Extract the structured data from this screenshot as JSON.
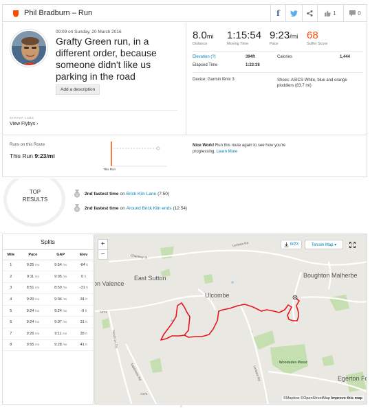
{
  "header": {
    "title": "Phil Bradburn – Run",
    "kudos_count": "1",
    "comment_count": "0",
    "icons": [
      "strava-shield-icon",
      "facebook-icon",
      "twitter-icon",
      "share-icon",
      "thumbs-up-icon",
      "comment-icon"
    ]
  },
  "activity": {
    "date": "09:09 on Sunday, 20 March 2016",
    "title": "Grafty Green run, in a different order, because someone didn't like us parking in the road",
    "add_description": "Add a description",
    "labs": "STRAVA LABS",
    "view_flybys": "View Flybys ›"
  },
  "stats": {
    "distance": {
      "value": "8.0",
      "unit": "mi",
      "label": "Distance"
    },
    "moving_time": {
      "value": "1:15:54",
      "label": "Moving Time"
    },
    "pace": {
      "value": "9:23",
      "unit": "/mi",
      "label": "Pace"
    },
    "suffer": {
      "value": "68",
      "label": "Suffer Score"
    },
    "elevation_label": "Elevation (?)",
    "elevation_value": "394ft",
    "calories_label": "Calories",
    "calories_value": "1,444",
    "elapsed_label": "Elapsed Time",
    "elapsed_value": "1:23:38",
    "device": "Device: Garmin fēnix 3",
    "shoes": "Shoes: ASICS White, blue and orange ploddiers (83.7 mi)"
  },
  "route": {
    "runs_label": "Runs on this Route",
    "this_run_label": "This Run",
    "this_run_value": "9:23/mi",
    "timeline_label": "This Run",
    "nice_work": "Nice Work!",
    "nice_work_text": "Run this route again to see how you're progressing.",
    "learn_more": "Learn More"
  },
  "results": {
    "title_1": "TOP",
    "title_2": "RESULTS",
    "items": [
      {
        "rank": "2nd fastest time",
        "on": "on",
        "segment": "Brick Kiln Lane",
        "time": "(7:50)"
      },
      {
        "rank": "2nd fastest time",
        "on": "on",
        "segment": "Around Brick Kiln ends",
        "time": "(12:54)"
      }
    ]
  },
  "splits": {
    "title": "Splits",
    "headers": [
      "Mile",
      "Pace",
      "GAP",
      "Elev"
    ],
    "rows": [
      [
        "1",
        "9:25",
        "9:54",
        "-84"
      ],
      [
        "2",
        "9:11",
        "9:05",
        "0"
      ],
      [
        "3",
        "8:51",
        "8:59",
        "-31"
      ],
      [
        "4",
        "9:20",
        "9:04",
        "34"
      ],
      [
        "5",
        "9:24",
        "9:24",
        "-9"
      ],
      [
        "6",
        "9:24",
        "9:07",
        "31"
      ],
      [
        "7",
        "9:26",
        "9:11",
        "28"
      ],
      [
        "8",
        "9:55",
        "9:28",
        "41"
      ]
    ],
    "pace_unit": "/mi",
    "elev_unit": "ft"
  },
  "map": {
    "zoom_in": "+",
    "zoom_out": "−",
    "gpx": "GPX",
    "terrain": "Terrain Map ▾",
    "fullscreen_icon": "fullscreen-icon",
    "attribution_1": "©Mapbox ©OpenStreetMap",
    "attribution_2": "Improve this map",
    "places": {
      "valence": "on Valence",
      "east_sutton": "East Sutton",
      "ulcombe": "Ulcombe",
      "boughton": "Boughton Malherbe",
      "egerton": "Egerton For",
      "woodsden": "Woodsden Wood"
    },
    "roads": {
      "chartway": "Chartway St",
      "lenham": "Lenham Rd",
      "headcorn": "Headcorn Rd",
      "maidstone": "Maidstone Rd",
      "lenham2": "Lenham Rd",
      "a274": "A274",
      "a274b": "A274"
    },
    "colors": {
      "route": "#e8161b",
      "water": "#a8cbe3",
      "wood": "#c6dfb0",
      "road": "#ffffff"
    }
  }
}
